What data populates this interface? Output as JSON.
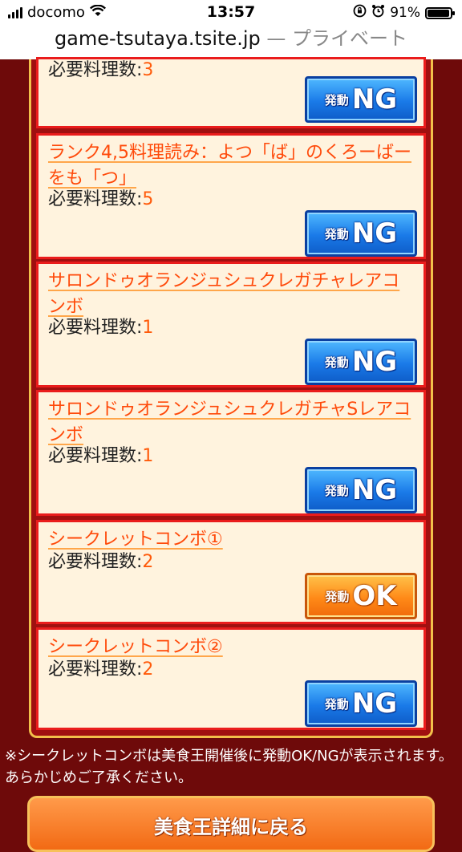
{
  "status_bar": {
    "carrier": "docomo",
    "time": "13:57",
    "battery": "91%",
    "battery_level": 0.91,
    "icons": [
      "signal-icon",
      "wifi-icon",
      "rotation-lock-icon",
      "alarm-icon",
      "battery-icon"
    ]
  },
  "url_bar": {
    "domain": "game-tsutaya.tsite.jp",
    "separator": "—",
    "mode": "プライベート"
  },
  "required_label": "必要料理数:",
  "cards": [
    {
      "title": "",
      "count": "3",
      "status": "NG"
    },
    {
      "title": "ランク4,5料理読み：よつ「ば」のくろーばーをも「つ」",
      "count": "5",
      "status": "NG"
    },
    {
      "title": "サロンドゥオランジュシュクレガチャレアコンボ",
      "count": "1",
      "status": "NG"
    },
    {
      "title": "サロンドゥオランジュシュクレガチャSレアコンボ",
      "count": "1",
      "status": "NG"
    },
    {
      "title": "シークレットコンボ①",
      "count": "2",
      "status": "OK"
    },
    {
      "title": "シークレットコンボ②",
      "count": "2",
      "status": "NG"
    }
  ],
  "badge_prefix": "発動",
  "note": "※シークレットコンボは美食王開催後に発動OK/NGが表示されます。あらかじめご了承ください。",
  "bottom_button": "美食王詳細に戻る",
  "colors": {
    "background": "#6e0a0a",
    "frame": "#a01010",
    "card": "#fff3de",
    "card_border": "#ea1c1c",
    "title_text": "#ff4a0a",
    "ng_button": "#1a7ae8",
    "ok_button": "#ff8a18"
  }
}
